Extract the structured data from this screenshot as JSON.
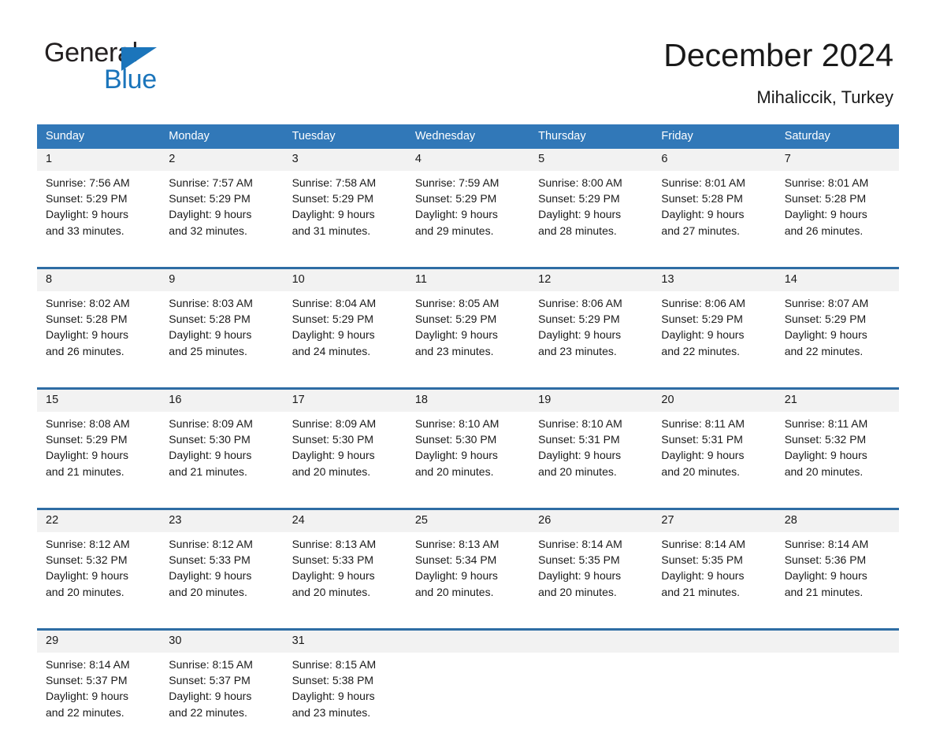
{
  "brand": {
    "name_dark": "General",
    "name_light": "Blue",
    "triangle_color": "#1b75bb"
  },
  "header": {
    "title": "December 2024",
    "location": "Mihaliccik, Turkey"
  },
  "theme": {
    "header_band": "#3178b8",
    "row_rule": "#2e6da4",
    "daynum_bg": "#f2f2f2",
    "page_bg": "#ffffff",
    "text": "#1a1a1a"
  },
  "calendar": {
    "weekday_headers": [
      "Sunday",
      "Monday",
      "Tuesday",
      "Wednesday",
      "Thursday",
      "Friday",
      "Saturday"
    ],
    "weeks": [
      {
        "days": [
          {
            "num": "1",
            "sunrise": "Sunrise: 7:56 AM",
            "sunset": "Sunset: 5:29 PM",
            "daylight_1": "Daylight: 9 hours",
            "daylight_2": "and 33 minutes."
          },
          {
            "num": "2",
            "sunrise": "Sunrise: 7:57 AM",
            "sunset": "Sunset: 5:29 PM",
            "daylight_1": "Daylight: 9 hours",
            "daylight_2": "and 32 minutes."
          },
          {
            "num": "3",
            "sunrise": "Sunrise: 7:58 AM",
            "sunset": "Sunset: 5:29 PM",
            "daylight_1": "Daylight: 9 hours",
            "daylight_2": "and 31 minutes."
          },
          {
            "num": "4",
            "sunrise": "Sunrise: 7:59 AM",
            "sunset": "Sunset: 5:29 PM",
            "daylight_1": "Daylight: 9 hours",
            "daylight_2": "and 29 minutes."
          },
          {
            "num": "5",
            "sunrise": "Sunrise: 8:00 AM",
            "sunset": "Sunset: 5:29 PM",
            "daylight_1": "Daylight: 9 hours",
            "daylight_2": "and 28 minutes."
          },
          {
            "num": "6",
            "sunrise": "Sunrise: 8:01 AM",
            "sunset": "Sunset: 5:28 PM",
            "daylight_1": "Daylight: 9 hours",
            "daylight_2": "and 27 minutes."
          },
          {
            "num": "7",
            "sunrise": "Sunrise: 8:01 AM",
            "sunset": "Sunset: 5:28 PM",
            "daylight_1": "Daylight: 9 hours",
            "daylight_2": "and 26 minutes."
          }
        ]
      },
      {
        "days": [
          {
            "num": "8",
            "sunrise": "Sunrise: 8:02 AM",
            "sunset": "Sunset: 5:28 PM",
            "daylight_1": "Daylight: 9 hours",
            "daylight_2": "and 26 minutes."
          },
          {
            "num": "9",
            "sunrise": "Sunrise: 8:03 AM",
            "sunset": "Sunset: 5:28 PM",
            "daylight_1": "Daylight: 9 hours",
            "daylight_2": "and 25 minutes."
          },
          {
            "num": "10",
            "sunrise": "Sunrise: 8:04 AM",
            "sunset": "Sunset: 5:29 PM",
            "daylight_1": "Daylight: 9 hours",
            "daylight_2": "and 24 minutes."
          },
          {
            "num": "11",
            "sunrise": "Sunrise: 8:05 AM",
            "sunset": "Sunset: 5:29 PM",
            "daylight_1": "Daylight: 9 hours",
            "daylight_2": "and 23 minutes."
          },
          {
            "num": "12",
            "sunrise": "Sunrise: 8:06 AM",
            "sunset": "Sunset: 5:29 PM",
            "daylight_1": "Daylight: 9 hours",
            "daylight_2": "and 23 minutes."
          },
          {
            "num": "13",
            "sunrise": "Sunrise: 8:06 AM",
            "sunset": "Sunset: 5:29 PM",
            "daylight_1": "Daylight: 9 hours",
            "daylight_2": "and 22 minutes."
          },
          {
            "num": "14",
            "sunrise": "Sunrise: 8:07 AM",
            "sunset": "Sunset: 5:29 PM",
            "daylight_1": "Daylight: 9 hours",
            "daylight_2": "and 22 minutes."
          }
        ]
      },
      {
        "days": [
          {
            "num": "15",
            "sunrise": "Sunrise: 8:08 AM",
            "sunset": "Sunset: 5:29 PM",
            "daylight_1": "Daylight: 9 hours",
            "daylight_2": "and 21 minutes."
          },
          {
            "num": "16",
            "sunrise": "Sunrise: 8:09 AM",
            "sunset": "Sunset: 5:30 PM",
            "daylight_1": "Daylight: 9 hours",
            "daylight_2": "and 21 minutes."
          },
          {
            "num": "17",
            "sunrise": "Sunrise: 8:09 AM",
            "sunset": "Sunset: 5:30 PM",
            "daylight_1": "Daylight: 9 hours",
            "daylight_2": "and 20 minutes."
          },
          {
            "num": "18",
            "sunrise": "Sunrise: 8:10 AM",
            "sunset": "Sunset: 5:30 PM",
            "daylight_1": "Daylight: 9 hours",
            "daylight_2": "and 20 minutes."
          },
          {
            "num": "19",
            "sunrise": "Sunrise: 8:10 AM",
            "sunset": "Sunset: 5:31 PM",
            "daylight_1": "Daylight: 9 hours",
            "daylight_2": "and 20 minutes."
          },
          {
            "num": "20",
            "sunrise": "Sunrise: 8:11 AM",
            "sunset": "Sunset: 5:31 PM",
            "daylight_1": "Daylight: 9 hours",
            "daylight_2": "and 20 minutes."
          },
          {
            "num": "21",
            "sunrise": "Sunrise: 8:11 AM",
            "sunset": "Sunset: 5:32 PM",
            "daylight_1": "Daylight: 9 hours",
            "daylight_2": "and 20 minutes."
          }
        ]
      },
      {
        "days": [
          {
            "num": "22",
            "sunrise": "Sunrise: 8:12 AM",
            "sunset": "Sunset: 5:32 PM",
            "daylight_1": "Daylight: 9 hours",
            "daylight_2": "and 20 minutes."
          },
          {
            "num": "23",
            "sunrise": "Sunrise: 8:12 AM",
            "sunset": "Sunset: 5:33 PM",
            "daylight_1": "Daylight: 9 hours",
            "daylight_2": "and 20 minutes."
          },
          {
            "num": "24",
            "sunrise": "Sunrise: 8:13 AM",
            "sunset": "Sunset: 5:33 PM",
            "daylight_1": "Daylight: 9 hours",
            "daylight_2": "and 20 minutes."
          },
          {
            "num": "25",
            "sunrise": "Sunrise: 8:13 AM",
            "sunset": "Sunset: 5:34 PM",
            "daylight_1": "Daylight: 9 hours",
            "daylight_2": "and 20 minutes."
          },
          {
            "num": "26",
            "sunrise": "Sunrise: 8:14 AM",
            "sunset": "Sunset: 5:35 PM",
            "daylight_1": "Daylight: 9 hours",
            "daylight_2": "and 20 minutes."
          },
          {
            "num": "27",
            "sunrise": "Sunrise: 8:14 AM",
            "sunset": "Sunset: 5:35 PM",
            "daylight_1": "Daylight: 9 hours",
            "daylight_2": "and 21 minutes."
          },
          {
            "num": "28",
            "sunrise": "Sunrise: 8:14 AM",
            "sunset": "Sunset: 5:36 PM",
            "daylight_1": "Daylight: 9 hours",
            "daylight_2": "and 21 minutes."
          }
        ]
      },
      {
        "days": [
          {
            "num": "29",
            "sunrise": "Sunrise: 8:14 AM",
            "sunset": "Sunset: 5:37 PM",
            "daylight_1": "Daylight: 9 hours",
            "daylight_2": "and 22 minutes."
          },
          {
            "num": "30",
            "sunrise": "Sunrise: 8:15 AM",
            "sunset": "Sunset: 5:37 PM",
            "daylight_1": "Daylight: 9 hours",
            "daylight_2": "and 22 minutes."
          },
          {
            "num": "31",
            "sunrise": "Sunrise: 8:15 AM",
            "sunset": "Sunset: 5:38 PM",
            "daylight_1": "Daylight: 9 hours",
            "daylight_2": "and 23 minutes."
          },
          {
            "num": "",
            "sunrise": "",
            "sunset": "",
            "daylight_1": "",
            "daylight_2": ""
          },
          {
            "num": "",
            "sunrise": "",
            "sunset": "",
            "daylight_1": "",
            "daylight_2": ""
          },
          {
            "num": "",
            "sunrise": "",
            "sunset": "",
            "daylight_1": "",
            "daylight_2": ""
          },
          {
            "num": "",
            "sunrise": "",
            "sunset": "",
            "daylight_1": "",
            "daylight_2": ""
          }
        ]
      }
    ]
  }
}
